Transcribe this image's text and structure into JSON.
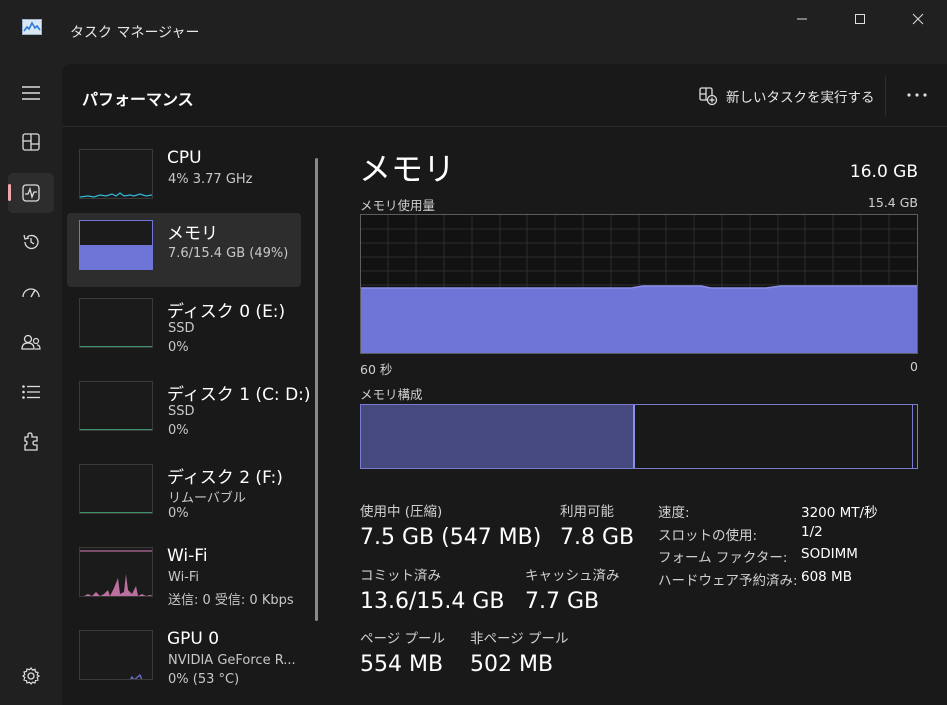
{
  "app": {
    "title": "タスク マネージャー"
  },
  "header": {
    "title": "パフォーマンス",
    "run_task": "新しいタスクを実行する"
  },
  "list": [
    {
      "name": "CPU",
      "line1": "4%  3.77 GHz",
      "line2": ""
    },
    {
      "name": "メモリ",
      "line1": "7.6/15.4 GB (49%)",
      "line2": ""
    },
    {
      "name": "ディスク 0 (E:)",
      "line1": "SSD",
      "line2": "0%"
    },
    {
      "name": "ディスク 1 (C: D:)",
      "line1": "SSD",
      "line2": "0%"
    },
    {
      "name": "ディスク 2 (F:)",
      "line1": "リムーバブル",
      "line2": "0%"
    },
    {
      "name": "Wi-Fi",
      "line1": "Wi-Fi",
      "line2": "送信: 0 受信: 0 Kbps"
    },
    {
      "name": "GPU 0",
      "line1": "NVIDIA GeForce R...",
      "line2": "0% (53 °C)"
    }
  ],
  "detail": {
    "title": "メモリ",
    "total": "16.0 GB",
    "usage_label": "メモリ使用量",
    "usage_max": "15.4 GB",
    "axis_left": "60 秒",
    "axis_right": "0",
    "composition_label": "メモリ構成",
    "in_use_fraction": 0.493,
    "stats": {
      "in_use_label": "使用中 (圧縮)",
      "in_use_value": "7.5 GB (547 MB)",
      "available_label": "利用可能",
      "available_value": "7.8 GB",
      "committed_label": "コミット済み",
      "committed_value": "13.6/15.4 GB",
      "cached_label": "キャッシュ済み",
      "cached_value": "7.7 GB",
      "paged_label": "ページ プール",
      "paged_value": "554 MB",
      "nonpaged_label": "非ページ プール",
      "nonpaged_value": "502 MB"
    },
    "props": [
      {
        "label": "速度:",
        "value": "3200 MT/秒"
      },
      {
        "label": "スロットの使用:",
        "value": "1/2"
      },
      {
        "label": "フォーム ファクター:",
        "value": "SODIMM"
      },
      {
        "label": "ハードウェア予約済み:",
        "value": "608 MB"
      }
    ]
  },
  "colors": {
    "memory": "#6e75d6",
    "memory_dark": "#45497e",
    "wifi": "#d77fb6",
    "cpu": "#2fb8d8",
    "accent": "#f0a6ae"
  }
}
